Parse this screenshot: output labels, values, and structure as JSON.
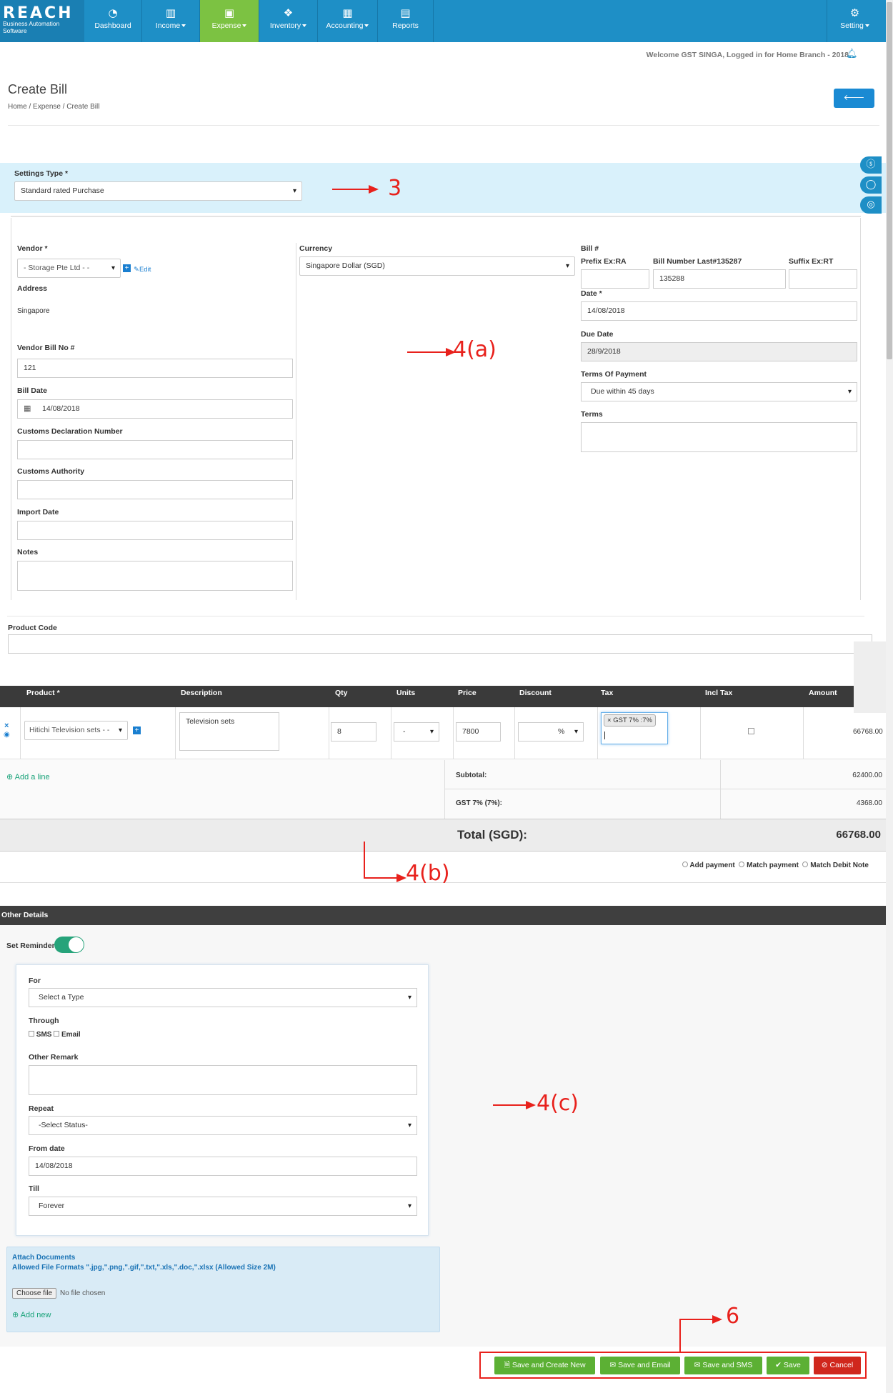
{
  "brand": {
    "logo": "REACH",
    "tagline": "Business Automation Software"
  },
  "nav": [
    {
      "label": "Dashboard",
      "icon": "dashboard-icon",
      "glyph": "◔"
    },
    {
      "label": "Income",
      "icon": "bar-chart-icon",
      "glyph": "▥"
    },
    {
      "label": "Expense",
      "icon": "money-icon",
      "glyph": "▣"
    },
    {
      "label": "Inventory",
      "icon": "cubes-icon",
      "glyph": "❖"
    },
    {
      "label": "Accounting",
      "icon": "calculator-icon",
      "glyph": "▦"
    },
    {
      "label": "Reports",
      "icon": "file-icon",
      "glyph": "▤"
    },
    {
      "label": "Setting",
      "icon": "gear-icon",
      "glyph": "⚙"
    }
  ],
  "welcome": "Welcome GST SINGA, Logged in for Home Branch - 2018",
  "page": {
    "title": "Create Bill",
    "breadcrumb": [
      "Home",
      "Expense",
      "Create Bill"
    ],
    "back": "Back"
  },
  "settings": {
    "label": "Settings Type *",
    "value": "Standard rated Purchase"
  },
  "form": {
    "vendor_label": "Vendor *",
    "vendor_value": "- Storage Pte Ltd - -",
    "edit": "Edit",
    "address_label": "Address",
    "address_value": "Singapore",
    "vendor_bill_label": "Vendor Bill No #",
    "vendor_bill_value": "121",
    "bill_date_label": "Bill Date",
    "bill_date_value": "14/08/2018",
    "customs_decl_label": "Customs Declaration Number",
    "customs_auth_label": "Customs Authority",
    "import_date_label": "Import Date",
    "notes_label": "Notes",
    "currency_label": "Currency",
    "currency_value": "Singapore Dollar (SGD)",
    "bill_no_label": "Bill #",
    "prefix_label": "Prefix Ex:RA",
    "bill_last_label": "Bill Number Last#135287",
    "bill_number_value": "135288",
    "suffix_label": "Suffix Ex:RT",
    "date_label": "Date *",
    "date_value": "14/08/2018",
    "due_label": "Due Date",
    "due_value": "28/9/2018",
    "terms_payment_label": "Terms Of Payment",
    "terms_payment_value": "Due within 45 days",
    "terms_label": "Terms",
    "product_code_label": "Product Code"
  },
  "table": {
    "headers": [
      "Product *",
      "Description",
      "Qty",
      "Units",
      "Price",
      "Discount",
      "Tax",
      "Incl Tax",
      "Amount"
    ],
    "row": {
      "product": "Hitichi Television sets - -",
      "description": "Television sets",
      "qty": "8",
      "units": "-",
      "price": "7800",
      "discount_unit": "%",
      "tax_tag": "GST 7% :7%",
      "amount": "66768.00"
    },
    "add_line": "Add a line",
    "subtotal_label": "Subtotal:",
    "subtotal_value": "62400.00",
    "gst_label": "GST 7% (7%):",
    "gst_value": "4368.00",
    "total_label": "Total (SGD):",
    "total_value": "66768.00",
    "payment_options": [
      "Add payment",
      "Match payment",
      "Match Debit Note"
    ]
  },
  "other": {
    "header": "Other Details",
    "reminder_label": "Set Reminder",
    "for_label": "For",
    "for_value": "Select a Type",
    "through_label": "Through",
    "sms": "SMS",
    "email": "Email",
    "remark_label": "Other Remark",
    "repeat_label": "Repeat",
    "repeat_value": "-Select Status-",
    "from_label": "From date",
    "from_value": "14/08/2018",
    "till_label": "Till",
    "till_value": "Forever"
  },
  "attach": {
    "title": "Attach Documents",
    "formats": "Allowed File Formats \".jpg,\".png,\".gif,\".txt,\".xls,\".doc,\".xlsx (Allowed Size 2M)",
    "choose": "Choose file",
    "nofile": "No file chosen",
    "add_new": "Add new"
  },
  "actions": {
    "save_create_new": "Save and Create New",
    "save_email": "Save and Email",
    "save_sms": "Save and SMS",
    "save": "Save",
    "cancel": "Cancel"
  },
  "annotations": {
    "a3": "3",
    "a4a": "4(a)",
    "a4b": "4(b)",
    "a4c": "4(c)",
    "a6": "6"
  },
  "colors": {
    "nav": "#1e8fc6",
    "active": "#7cc242",
    "annotation": "#e8211c",
    "save": "#5cb034",
    "cancel": "#d0271d"
  }
}
